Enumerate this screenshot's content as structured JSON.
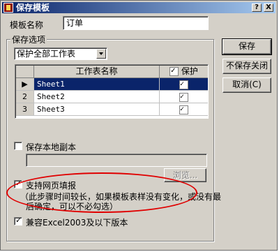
{
  "window": {
    "title": "保存模板",
    "help_label": "?",
    "close_label": "X"
  },
  "template_name": {
    "label": "模板名称",
    "value": "订单"
  },
  "options": {
    "group_title": "保存选项",
    "protect_select": "保护全部工作表",
    "grid": {
      "col_sheet": "工作表名称",
      "col_protect": "保护",
      "rows": [
        {
          "num": "1",
          "name": "Sheet1",
          "protected": true
        },
        {
          "num": "2",
          "name": "Sheet2",
          "protected": true
        },
        {
          "num": "3",
          "name": "Sheet3",
          "protected": true
        }
      ]
    },
    "local_copy_label": "保存本地副本",
    "browse_label": "浏览...",
    "web_fill_label": "支持网页填报",
    "web_fill_note_line1": "（此步骤时间较长，如果模板表样没有变化，或没有最",
    "web_fill_note_line2": "后确定，可以不必勾选）",
    "compat_label": "兼容Excel2003及以下版本"
  },
  "buttons": {
    "save": "保存",
    "close_no_save": "不保存关闭",
    "cancel": "取消(C)"
  },
  "colors": {
    "selection": "#0a246a",
    "highlight_ellipse": "#e00000"
  }
}
